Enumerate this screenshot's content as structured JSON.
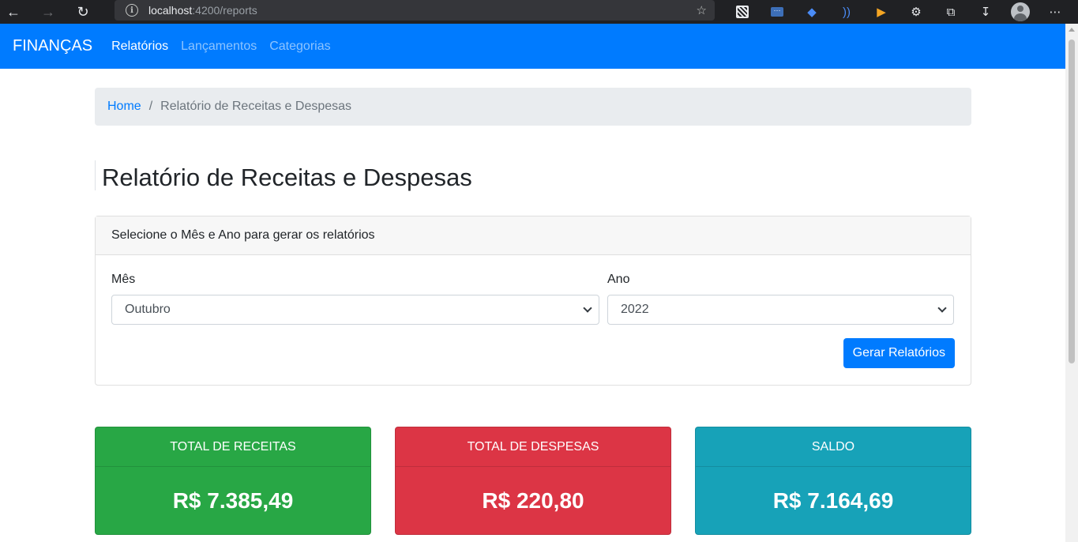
{
  "browser": {
    "url_host": "localhost",
    "url_path": ":4200/reports"
  },
  "navbar": {
    "brand": "FINANÇAS",
    "links": [
      "Relatórios",
      "Lançamentos",
      "Categorias"
    ]
  },
  "breadcrumb": {
    "home": "Home",
    "separator": "/",
    "current": "Relatório de Receitas e Despesas"
  },
  "page_title": "Relatório de Receitas e Despesas",
  "filter_card": {
    "header": "Selecione o Mês e Ano para gerar os relatórios",
    "month_label": "Mês",
    "month_value": "Outubro",
    "year_label": "Ano",
    "year_value": "2022",
    "submit_label": "Gerar Relatórios"
  },
  "totals": {
    "income_label": "TOTAL DE RECEITAS",
    "income_value": "R$ 7.385,49",
    "expense_label": "TOTAL DE DESPESAS",
    "expense_value": "R$ 220,80",
    "balance_label": "SALDO",
    "balance_value": "R$ 7.164,69"
  },
  "colors": {
    "primary": "#007bff",
    "income": "#28a745",
    "expense": "#dc3545",
    "balance": "#17a2b8"
  }
}
